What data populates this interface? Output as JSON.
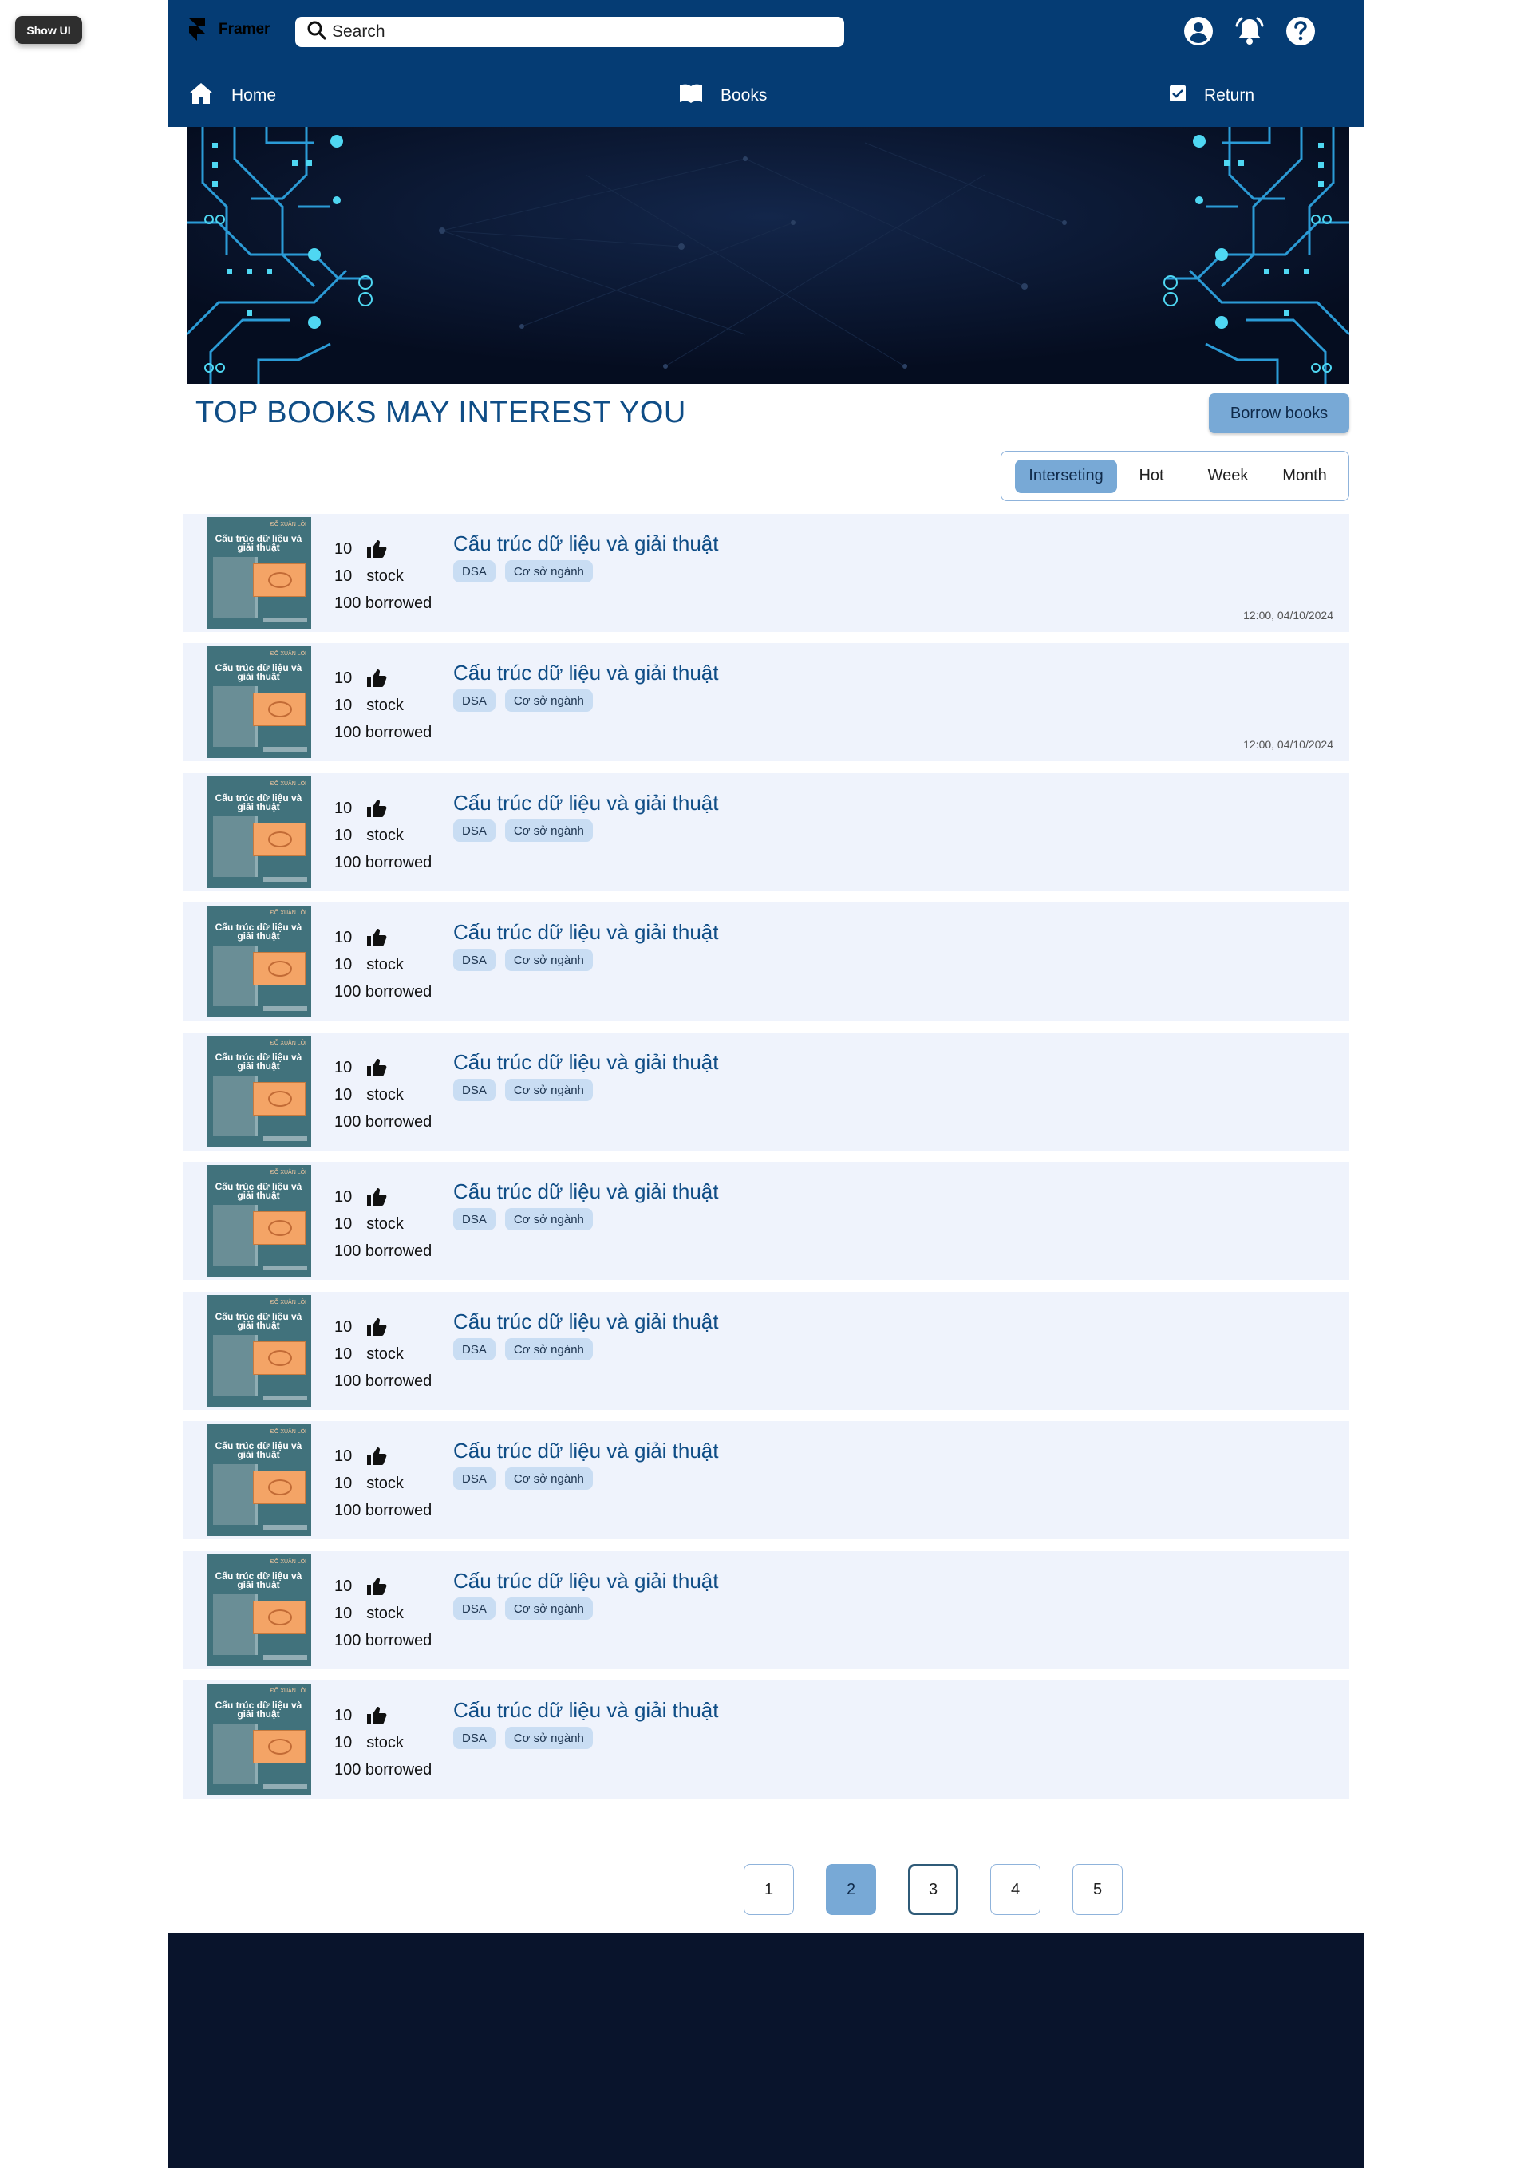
{
  "overlay": {
    "show_ui_label": "Show UI"
  },
  "header": {
    "brand": "Framer",
    "search_placeholder": "Search",
    "icons": [
      "account-icon",
      "bell-icon",
      "help-icon"
    ],
    "nav": [
      {
        "label": "Home",
        "icon": "home-icon"
      },
      {
        "label": "Books",
        "icon": "book-icon"
      },
      {
        "label": "Return",
        "icon": "checkbox-icon"
      }
    ]
  },
  "section": {
    "title": "TOP BOOKS MAY INTEREST YOU",
    "borrow_label": "Borrow books",
    "filters": [
      "Interseting",
      "Hot",
      "Week",
      "Month"
    ],
    "active_filter": "Interseting"
  },
  "books": [
    {
      "likes": "10",
      "stock": "10",
      "stock_label": "stock",
      "borrowed": "100 borrowed",
      "title": "Cấu trúc dữ liệu và giải thuật",
      "tags": [
        "DSA",
        "Cơ sở ngành"
      ],
      "time": "12:00, 04/10/2024",
      "cover_author": "ĐỖ XUÂN LÔI",
      "cover_title": "Cấu trúc dữ liệu và giải thuật"
    },
    {
      "likes": "10",
      "stock": "10",
      "stock_label": "stock",
      "borrowed": "100 borrowed",
      "title": "Cấu trúc dữ liệu và giải thuật",
      "tags": [
        "DSA",
        "Cơ sở ngành"
      ],
      "time": "12:00, 04/10/2024",
      "cover_author": "ĐỖ XUÂN LÔI",
      "cover_title": "Cấu trúc dữ liệu và giải thuật"
    },
    {
      "likes": "10",
      "stock": "10",
      "stock_label": "stock",
      "borrowed": "100 borrowed",
      "title": "Cấu trúc dữ liệu và giải thuật",
      "tags": [
        "DSA",
        "Cơ sở ngành"
      ],
      "time": "",
      "cover_author": "ĐỖ XUÂN LÔI",
      "cover_title": "Cấu trúc dữ liệu và giải thuật"
    },
    {
      "likes": "10",
      "stock": "10",
      "stock_label": "stock",
      "borrowed": "100 borrowed",
      "title": "Cấu trúc dữ liệu và giải thuật",
      "tags": [
        "DSA",
        "Cơ sở ngành"
      ],
      "time": "",
      "cover_author": "ĐỖ XUÂN LÔI",
      "cover_title": "Cấu trúc dữ liệu và giải thuật"
    },
    {
      "likes": "10",
      "stock": "10",
      "stock_label": "stock",
      "borrowed": "100 borrowed",
      "title": "Cấu trúc dữ liệu và giải thuật",
      "tags": [
        "DSA",
        "Cơ sở ngành"
      ],
      "time": "",
      "cover_author": "ĐỖ XUÂN LÔI",
      "cover_title": "Cấu trúc dữ liệu và giải thuật"
    },
    {
      "likes": "10",
      "stock": "10",
      "stock_label": "stock",
      "borrowed": "100 borrowed",
      "title": "Cấu trúc dữ liệu và giải thuật",
      "tags": [
        "DSA",
        "Cơ sở ngành"
      ],
      "time": "",
      "cover_author": "ĐỖ XUÂN LÔI",
      "cover_title": "Cấu trúc dữ liệu và giải thuật"
    },
    {
      "likes": "10",
      "stock": "10",
      "stock_label": "stock",
      "borrowed": "100 borrowed",
      "title": "Cấu trúc dữ liệu và giải thuật",
      "tags": [
        "DSA",
        "Cơ sở ngành"
      ],
      "time": "",
      "cover_author": "ĐỖ XUÂN LÔI",
      "cover_title": "Cấu trúc dữ liệu và giải thuật"
    },
    {
      "likes": "10",
      "stock": "10",
      "stock_label": "stock",
      "borrowed": "100 borrowed",
      "title": "Cấu trúc dữ liệu và giải thuật",
      "tags": [
        "DSA",
        "Cơ sở ngành"
      ],
      "time": "",
      "cover_author": "ĐỖ XUÂN LÔI",
      "cover_title": "Cấu trúc dữ liệu và giải thuật"
    },
    {
      "likes": "10",
      "stock": "10",
      "stock_label": "stock",
      "borrowed": "100 borrowed",
      "title": "Cấu trúc dữ liệu và giải thuật",
      "tags": [
        "DSA",
        "Cơ sở ngành"
      ],
      "time": "",
      "cover_author": "ĐỖ XUÂN LÔI",
      "cover_title": "Cấu trúc dữ liệu và giải thuật"
    },
    {
      "likes": "10",
      "stock": "10",
      "stock_label": "stock",
      "borrowed": "100 borrowed",
      "title": "Cấu trúc dữ liệu và giải thuật",
      "tags": [
        "DSA",
        "Cơ sở ngành"
      ],
      "time": "",
      "cover_author": "ĐỖ XUÂN LÔI",
      "cover_title": "Cấu trúc dữ liệu và giải thuật"
    }
  ],
  "pagination": {
    "pages": [
      "1",
      "2",
      "3",
      "4",
      "5"
    ],
    "current": "2",
    "focused": "3"
  },
  "colors": {
    "header": "#053c74",
    "accent": "#78a9d6",
    "row_bg": "#eff3fc",
    "title": "#0f4d86",
    "footer": "#09142c"
  }
}
